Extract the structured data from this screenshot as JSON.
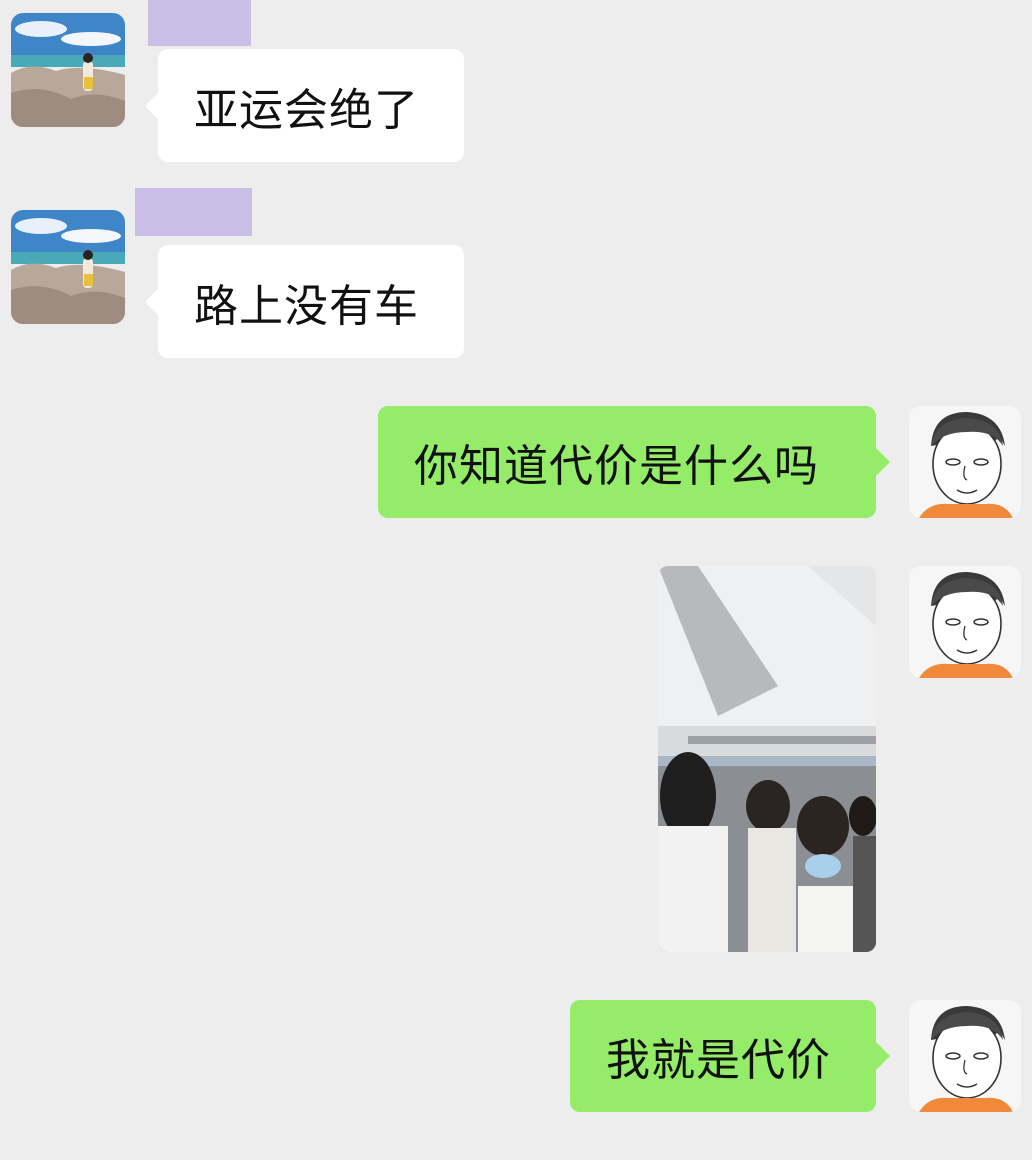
{
  "chat": {
    "messages": [
      {
        "sender": "other",
        "type": "text",
        "text": "亚运会绝了"
      },
      {
        "sender": "other",
        "type": "text",
        "text": "路上没有车"
      },
      {
        "sender": "self",
        "type": "text",
        "text": "你知道代价是什么吗"
      },
      {
        "sender": "self",
        "type": "image",
        "content": "crowded subway car photo"
      },
      {
        "sender": "self",
        "type": "text",
        "text": "我就是代价"
      }
    ]
  },
  "colors": {
    "background": "#ededed",
    "incoming_bubble": "#ffffff",
    "outgoing_bubble": "#95ec69",
    "name_redaction": "#c9bfe6"
  },
  "icons": {
    "other_avatar": "seaside-photo-avatar",
    "self_avatar": "cartoon-boy-avatar"
  }
}
